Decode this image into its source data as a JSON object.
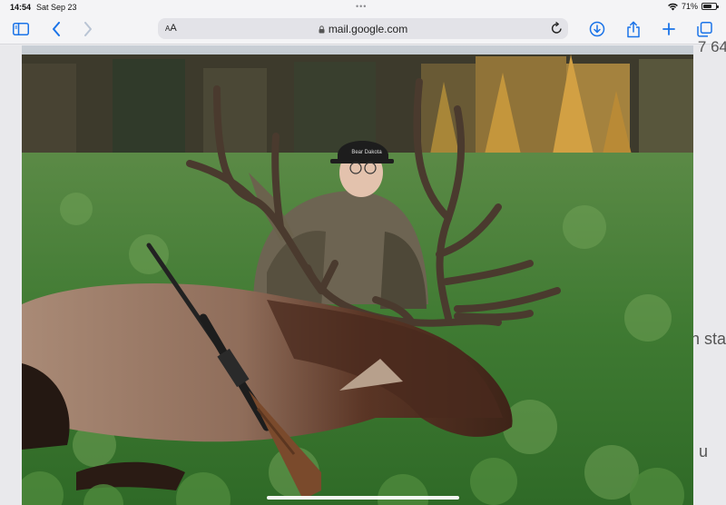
{
  "status_bar": {
    "time": "14:54",
    "date": "Sat Sep 23",
    "battery_percent": "71%",
    "battery_level": 0.71
  },
  "toolbar": {
    "text_size_label": "AA",
    "url": "mail.google.com",
    "icons": [
      "sidebar-icon",
      "back-icon",
      "forward-icon",
      "download-icon",
      "share-icon",
      "new-tab-icon",
      "tabs-icon",
      "reload-icon",
      "lock-icon"
    ]
  },
  "background_email": {
    "fragment_top": "7 64",
    "fragment_mid": "h sta",
    "fragment_low": "u"
  },
  "photo": {
    "description_icon": "photo-image",
    "cap_text": "Bear Dakota"
  },
  "colors": {
    "accent": "#1a73e8",
    "chrome": "#f4f4f6"
  }
}
